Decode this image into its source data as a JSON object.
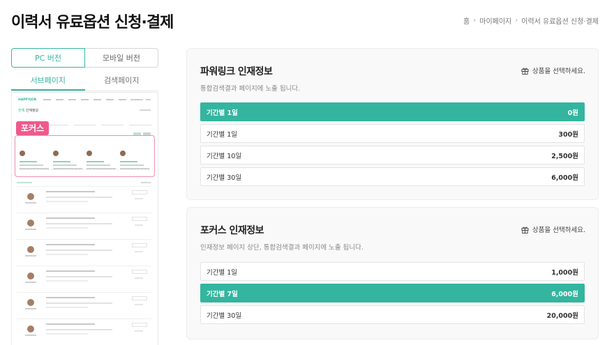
{
  "page": {
    "title": "이력서 유료옵션 신청·결제"
  },
  "breadcrumb": [
    "홈",
    "마이페이지",
    "이력서 유료옵션 신청·결제"
  ],
  "preview": {
    "device_tabs": [
      "PC 버전",
      "모바일 버전"
    ],
    "page_tabs": [
      "서브페이지",
      "검색페이지"
    ],
    "mock_logo": "HAPPYJOB",
    "mock_subtitle_a": "전체",
    "mock_subtitle_b": "인재정보",
    "focus_label": "포커스"
  },
  "panels": [
    {
      "title": "파워링크 인재정보",
      "desc": "통합검색결과 페이지에 노출 됩니다.",
      "select_label": "상품을 선택하세요.",
      "options": [
        {
          "label": "기간별   1일",
          "price": "0원",
          "selected": true
        },
        {
          "label": "기간별   1일",
          "price": "300원",
          "selected": false
        },
        {
          "label": "기간별   10일",
          "price": "2,500원",
          "selected": false
        },
        {
          "label": "기간별   30일",
          "price": "6,000원",
          "selected": false
        }
      ]
    },
    {
      "title": "포커스 인재정보",
      "desc": "인재정보 페이지 상단, 통합검색결과 페이지에 노출 됩니다.",
      "select_label": "상품을 선택하세요.",
      "options": [
        {
          "label": "기간별   1일",
          "price": "1,000원",
          "selected": false
        },
        {
          "label": "기간별   7일",
          "price": "6,000원",
          "selected": true
        },
        {
          "label": "기간별   30일",
          "price": "20,000원",
          "selected": false
        }
      ]
    }
  ],
  "colors": {
    "accent": "#34b59f",
    "focus": "#ee5a8c"
  },
  "icons": {
    "select": "gift-icon",
    "separator": "chevron-right-icon"
  }
}
